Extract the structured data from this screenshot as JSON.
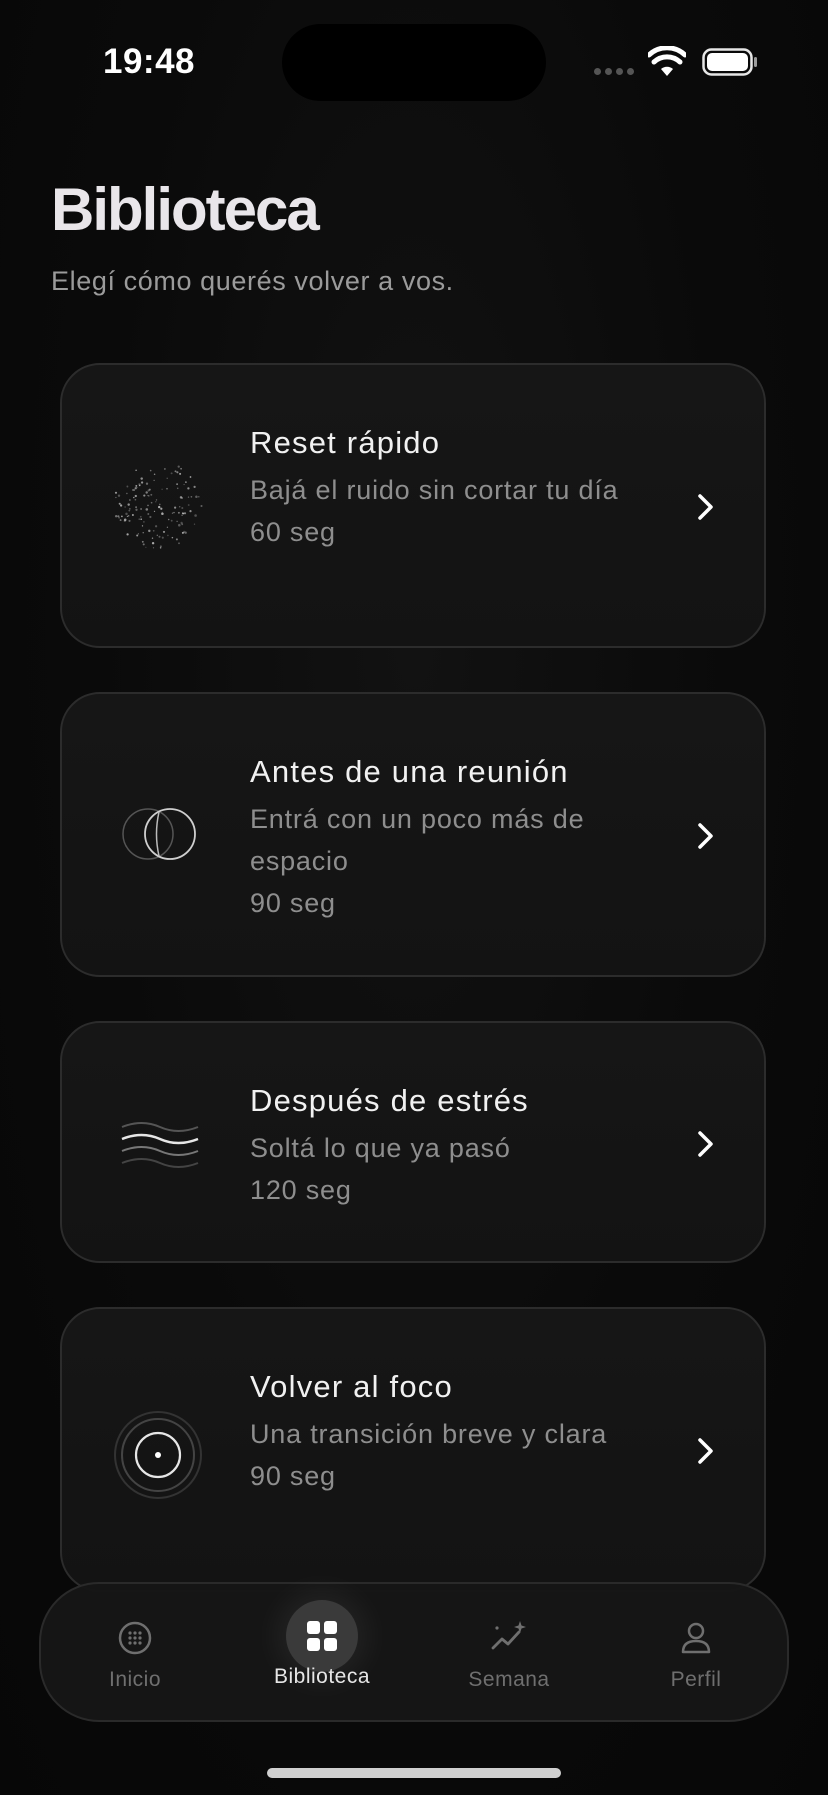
{
  "status": {
    "time": "19:48"
  },
  "header": {
    "title": "Biblioteca",
    "subtitle": "Elegí cómo querés volver a vos."
  },
  "cards": [
    {
      "title": "Reset rápido",
      "description": "Bajá el ruido sin cortar tu día",
      "duration": "60 seg",
      "icon": "particle-sphere-icon"
    },
    {
      "title": "Antes de una reunión",
      "description": "Entrá con un poco más de espacio",
      "duration": "90 seg",
      "icon": "overlapping-circles-icon"
    },
    {
      "title": "Después de estrés",
      "description": "Soltá lo que ya pasó",
      "duration": "120 seg",
      "icon": "waves-icon"
    },
    {
      "title": "Volver al foco",
      "description": "Una transición breve y clara",
      "duration": "90 seg",
      "icon": "target-icon"
    }
  ],
  "tabbar": {
    "items": [
      {
        "label": "Inicio",
        "icon": "dotted-circle-icon",
        "active": false
      },
      {
        "label": "Biblioteca",
        "icon": "grid-icon",
        "active": true
      },
      {
        "label": "Semana",
        "icon": "trend-sparkle-icon",
        "active": false
      },
      {
        "label": "Perfil",
        "icon": "person-icon",
        "active": false
      }
    ]
  },
  "colors": {
    "background": "#0a0a0a",
    "card": "#151515",
    "text_primary": "#f1f1f1",
    "text_secondary": "#8e8e8e"
  }
}
